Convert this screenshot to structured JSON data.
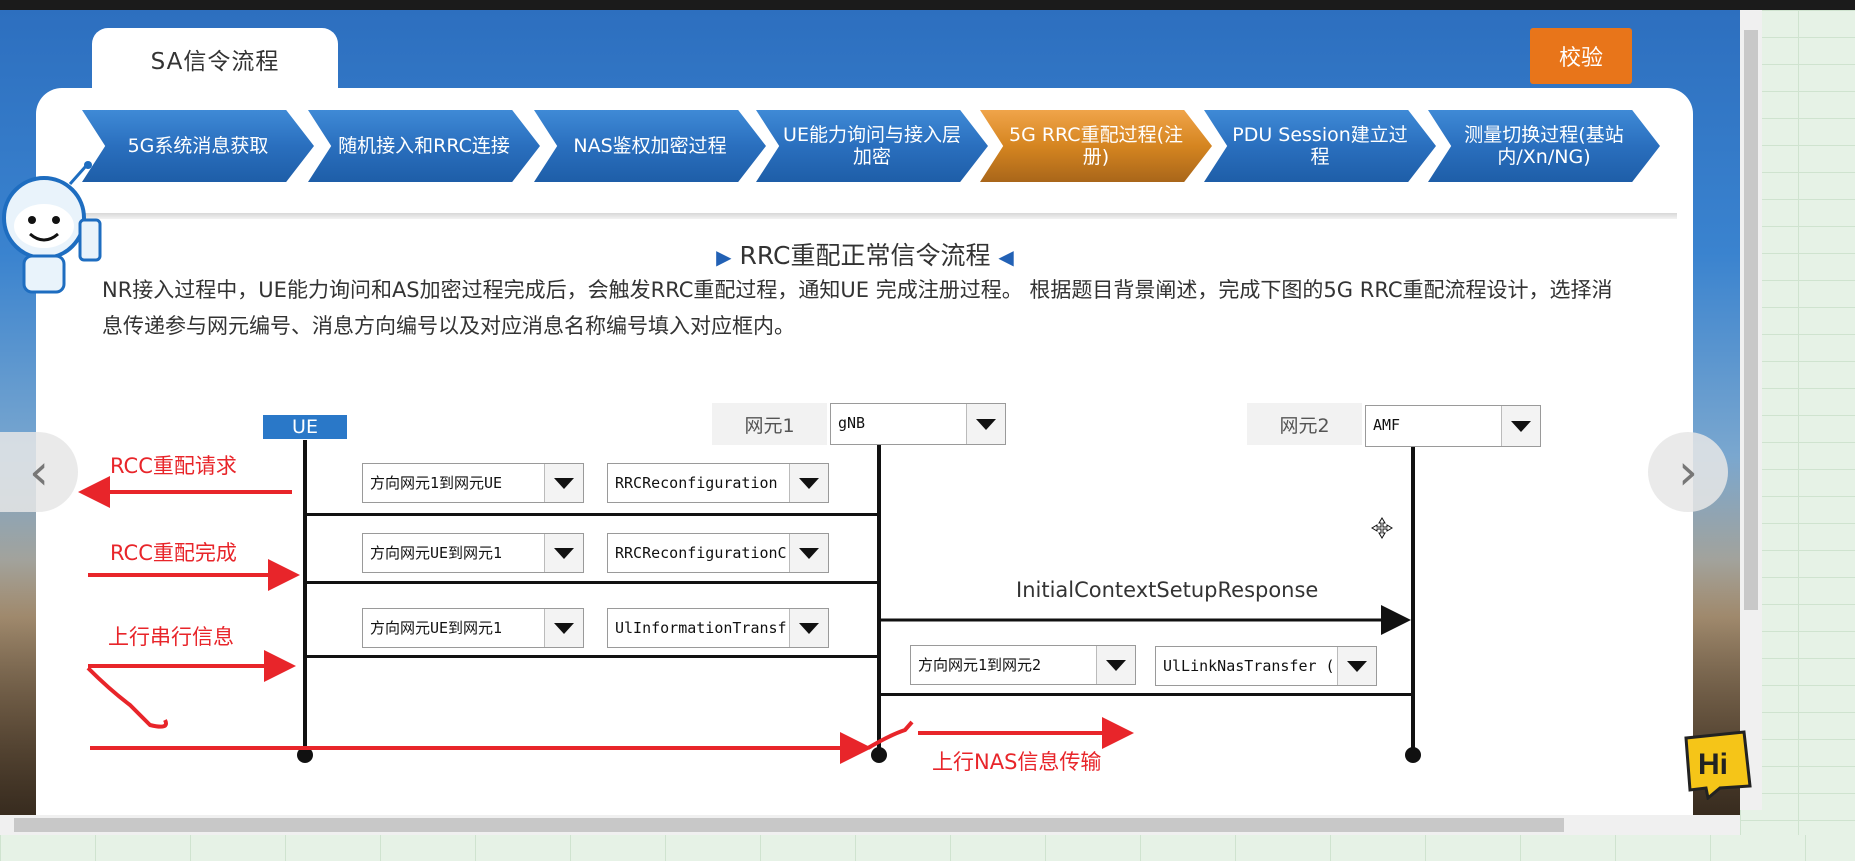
{
  "tab": {
    "label": "SA信令流程"
  },
  "check_button": {
    "label": "校验"
  },
  "steps": [
    {
      "label": "5G系统消息获取",
      "state": "normal"
    },
    {
      "label": "随机接入和RRC连接",
      "state": "normal"
    },
    {
      "label": "NAS鉴权加密过程",
      "state": "normal"
    },
    {
      "label": "UE能力询问与接入层加密",
      "state": "normal"
    },
    {
      "label": "5G RRC重配过程(注册)",
      "state": "active"
    },
    {
      "label": "PDU Session建立过程",
      "state": "normal"
    },
    {
      "label": "测量切换过程(基站内/Xn/NG)",
      "state": "normal"
    }
  ],
  "section": {
    "title": "RRC重配正常信令流程",
    "description": "NR接入过程中，UE能力询问和AS加密过程完成后，会触发RRC重配过程，通知UE 完成注册过程。 根据题目背景阐述，完成下图的5G RRC重配流程设计，选择消息传递参与网元编号、消息方向编号以及对应消息名称编号填入对应框内。"
  },
  "diagram": {
    "ue_label": "UE",
    "ne1": {
      "label": "网元1",
      "value": "gNB"
    },
    "ne2": {
      "label": "网元2",
      "value": "AMF"
    },
    "rows": [
      {
        "direction": "方向网元1到网元UE",
        "message": "RRCReconfiguration"
      },
      {
        "direction": "方向网元UE到网元1",
        "message": "RRCReconfigurationC"
      },
      {
        "direction": "方向网元UE到网元1",
        "message": "UlInformationTransf"
      },
      {
        "direction": "方向网元1到网元2",
        "message": "UlLinkNasTransfer ("
      }
    ],
    "message_label": "InitialContextSetupResponse",
    "annotations": [
      "RCC重配请求",
      "RCC重配完成",
      "上行串行信息",
      "上行NAS信息传输"
    ]
  },
  "mascot": {
    "hi": "Hi"
  },
  "colors": {
    "accent_blue": "#2a6fbe",
    "accent_orange": "#e8751a",
    "annotation_red": "#e8252a"
  }
}
